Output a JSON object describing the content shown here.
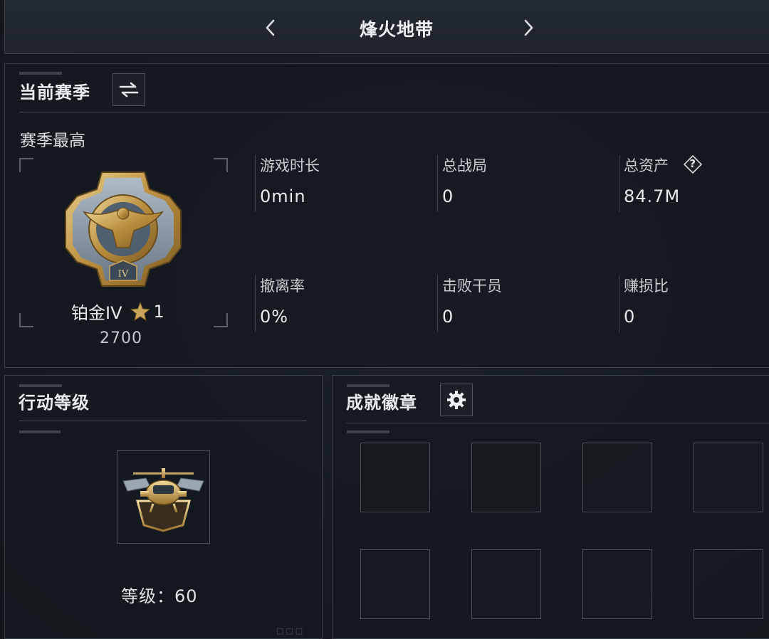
{
  "header": {
    "title": "烽火地带"
  },
  "season": {
    "title": "当前赛季",
    "subtitle": "赛季最高",
    "rank_name": "铂金IV",
    "rank_stars": "1",
    "rank_score": "2700",
    "rank_emblem_numeral": "IV",
    "stats": [
      {
        "label": "游戏时长",
        "value": "0min"
      },
      {
        "label": "总战局",
        "value": "0"
      },
      {
        "label": "总资产",
        "value": "84.7M",
        "help": "?"
      },
      {
        "label": "撤离率",
        "value": "0%"
      },
      {
        "label": "击败干员",
        "value": "0"
      },
      {
        "label": "赚损比",
        "value": "0"
      }
    ]
  },
  "action_level": {
    "title": "行动等级",
    "level_text": "等级：60"
  },
  "achievements": {
    "title": "成就徽章",
    "slot_count": 8
  },
  "icons": {
    "prev": "chevron-left-icon",
    "next": "chevron-right-icon",
    "switch": "swap-arrows-icon",
    "settings": "gear-icon",
    "help": "question-diamond-icon",
    "star": "star-icon"
  },
  "colors": {
    "gold": "#c9a45a",
    "accent_text": "#e7ebed",
    "border": "#3a4048"
  }
}
